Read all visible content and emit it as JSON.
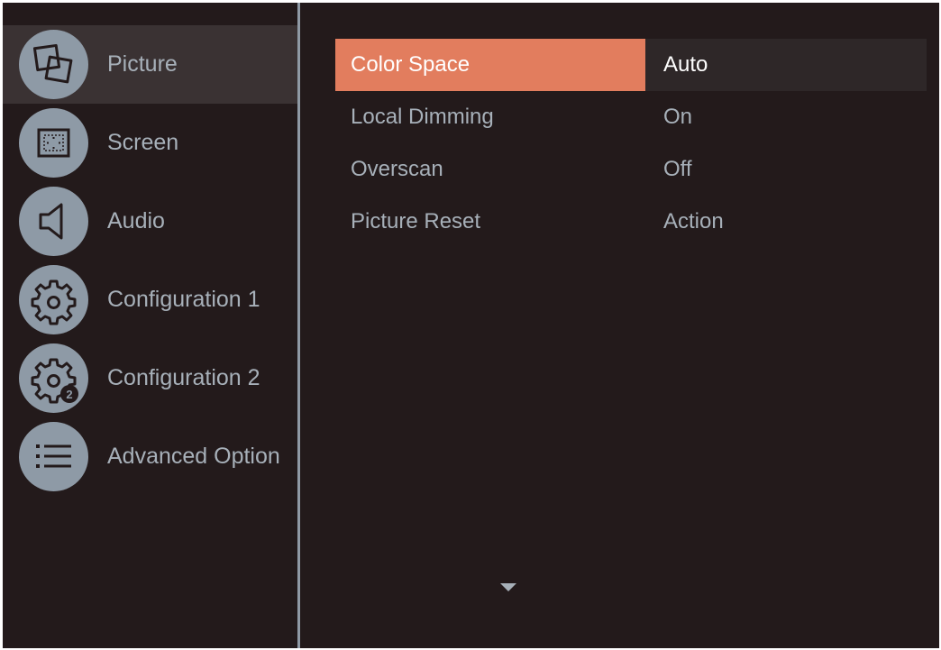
{
  "sidebar": {
    "items": [
      {
        "label": "Picture",
        "icon": "picture-icon",
        "selected": true
      },
      {
        "label": "Screen",
        "icon": "screen-icon",
        "selected": false
      },
      {
        "label": "Audio",
        "icon": "speaker-icon",
        "selected": false
      },
      {
        "label": "Configuration 1",
        "icon": "gear-icon",
        "selected": false
      },
      {
        "label": "Configuration 2",
        "icon": "gear-2-icon",
        "selected": false
      },
      {
        "label": "Advanced Option",
        "icon": "list-icon",
        "selected": false
      }
    ]
  },
  "settings": {
    "rows": [
      {
        "label": "Color Space",
        "value": "Auto",
        "selected": true
      },
      {
        "label": "Local Dimming",
        "value": "On",
        "selected": false
      },
      {
        "label": "Overscan",
        "value": "Off",
        "selected": false
      },
      {
        "label": "Picture Reset",
        "value": "Action",
        "selected": false
      }
    ]
  },
  "colors": {
    "background": "#231a1b",
    "highlight": "#e27d5e",
    "icon_circle": "#8e9aa6",
    "text": "#a7b0b9"
  },
  "scroll_indicator": {
    "icon": "chevron-down-icon"
  }
}
